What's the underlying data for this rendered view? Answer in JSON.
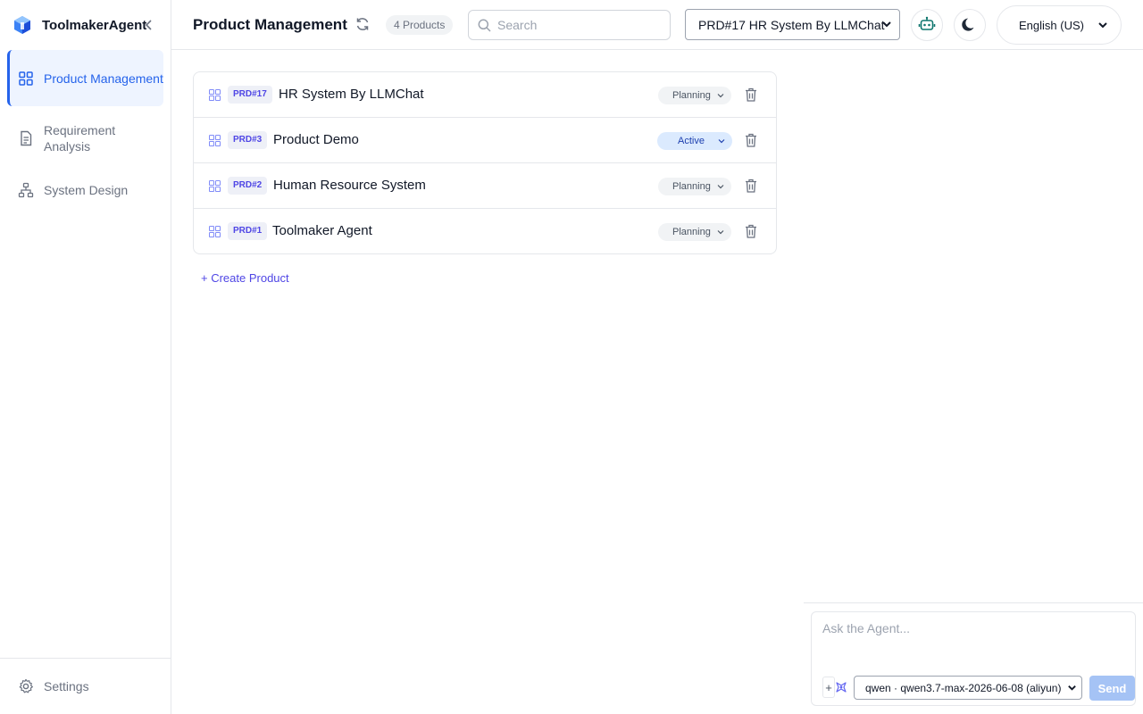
{
  "brand": {
    "name": "ToolmakerAgent"
  },
  "sidebar": {
    "items": [
      {
        "label": "Product Management",
        "icon": "grid-icon",
        "active": true
      },
      {
        "label": "Requirement Analysis",
        "icon": "document-icon",
        "active": false
      },
      {
        "label": "System Design",
        "icon": "sitemap-icon",
        "active": false
      }
    ],
    "settings_label": "Settings"
  },
  "header": {
    "title": "Product Management",
    "product_count": "4 Products",
    "search_placeholder": "Search",
    "selected_product": "PRD#17 HR System By LLMChat",
    "language": "English (US)"
  },
  "products": [
    {
      "code": "PRD#17",
      "name": "HR System By LLMChat",
      "status": "Planning"
    },
    {
      "code": "PRD#3",
      "name": "Product Demo",
      "status": "Active"
    },
    {
      "code": "PRD#2",
      "name": "Human Resource System",
      "status": "Planning"
    },
    {
      "code": "PRD#1",
      "name": "Toolmaker Agent",
      "status": "Planning"
    }
  ],
  "create_label": "+ Create Product",
  "agent": {
    "placeholder": "Ask the Agent...",
    "attach_label": "+",
    "model": "qwen · qwen3.7-max-2026-06-08 (aliyun)",
    "send_label": "Send"
  },
  "colors": {
    "accent": "#2563eb",
    "code_text": "#4f46e5",
    "active_badge": "#dbeafe",
    "planning_badge": "#f1f3f5",
    "send_disabled": "#a5c3f5"
  }
}
